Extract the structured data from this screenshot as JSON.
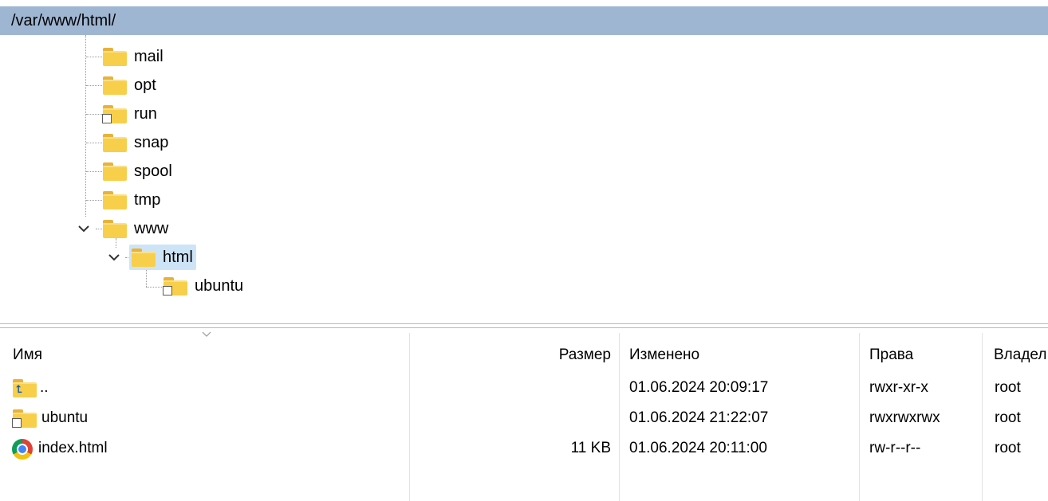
{
  "path_bar": {
    "path": "/var/www/html/"
  },
  "tree": {
    "items": [
      {
        "label": "mail",
        "icon": "folder-icon"
      },
      {
        "label": "opt",
        "icon": "folder-icon"
      },
      {
        "label": "run",
        "icon": "folder-link-icon"
      },
      {
        "label": "snap",
        "icon": "folder-icon"
      },
      {
        "label": "spool",
        "icon": "folder-icon"
      },
      {
        "label": "tmp",
        "icon": "folder-icon"
      },
      {
        "label": "www",
        "icon": "folder-icon",
        "expanded": true
      },
      {
        "label": "html",
        "icon": "folder-icon",
        "expanded": true,
        "selected": true
      },
      {
        "label": "ubuntu",
        "icon": "folder-link-icon"
      }
    ]
  },
  "file_list": {
    "columns": {
      "name": "Имя",
      "size": "Размер",
      "modified": "Изменено",
      "permissions": "Права",
      "owner": "Владел"
    },
    "rows": [
      {
        "name": "..",
        "size": "",
        "modified": "01.06.2024 20:09:17",
        "permissions": "rwxr-xr-x",
        "owner": "root",
        "icon": "parent-folder-icon"
      },
      {
        "name": "ubuntu",
        "size": "",
        "modified": "01.06.2024 21:22:07",
        "permissions": "rwxrwxrwx",
        "owner": "root",
        "icon": "folder-link-icon"
      },
      {
        "name": "index.html",
        "size": "11 KB",
        "modified": "01.06.2024 20:11:00",
        "permissions": "rw-r--r--",
        "owner": "root",
        "icon": "chrome-icon"
      }
    ]
  },
  "colors": {
    "path_bar": "#9eb6d2",
    "selection": "#cde4f7",
    "folder": "#f8cf4a"
  }
}
